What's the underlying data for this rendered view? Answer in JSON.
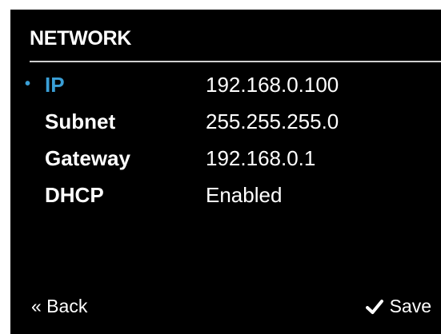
{
  "screen": {
    "title": "NETWORK",
    "accent_color": "#3a9fd6",
    "background_color": "#000000"
  },
  "rows": [
    {
      "label": "IP",
      "value": "192.168.0.100",
      "selected": true
    },
    {
      "label": "Subnet",
      "value": "255.255.255.0",
      "selected": false
    },
    {
      "label": "Gateway",
      "value": "192.168.0.1",
      "selected": false
    },
    {
      "label": "DHCP",
      "value": "Enabled",
      "selected": false
    }
  ],
  "footer": {
    "back_label": "« Back",
    "save_label": "Save",
    "save_icon": "check-icon"
  },
  "selection_marker": "•"
}
